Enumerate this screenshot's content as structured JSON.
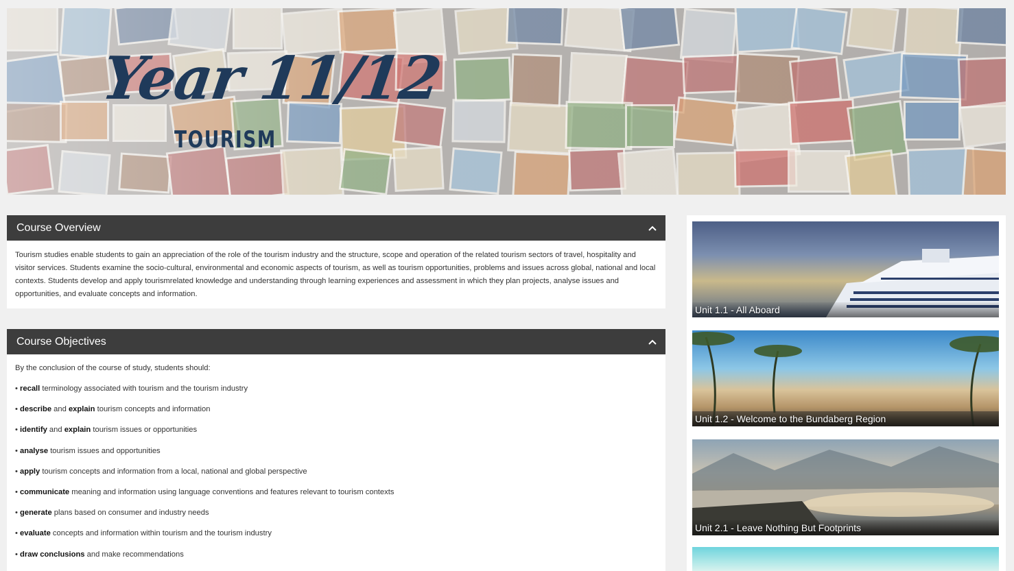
{
  "banner": {
    "title": "Year 11/12",
    "subtitle": "TOURISM"
  },
  "overview": {
    "heading": "Course Overview",
    "text": "Tourism studies enable students to gain an appreciation of the role of the tourism industry and the structure, scope and operation of the related tourism sectors of travel, hospitality and visitor services. Students examine the socio-cultural, environmental and economic aspects of tourism, as well as tourism opportunities, problems and issues across global, national and local contexts. Students develop and apply tourismrelated knowledge and understanding through learning experiences and assessment in which they plan projects, analyse issues and opportunities, and evaluate concepts and information."
  },
  "objectives": {
    "heading": "Course Objectives",
    "intro": "By the conclusion of the course of study, students should:",
    "items": [
      {
        "parts": [
          {
            "b": "recall"
          },
          {
            "t": " terminology associated with tourism and the tourism industry"
          }
        ]
      },
      {
        "parts": [
          {
            "b": "describe"
          },
          {
            "t": " and "
          },
          {
            "b": "explain"
          },
          {
            "t": " tourism concepts and information"
          }
        ]
      },
      {
        "parts": [
          {
            "b": "identify"
          },
          {
            "t": " and "
          },
          {
            "b": "explain"
          },
          {
            "t": " tourism issues or opportunities"
          }
        ]
      },
      {
        "parts": [
          {
            "b": "analyse"
          },
          {
            "t": " tourism issues and opportunities"
          }
        ]
      },
      {
        "parts": [
          {
            "b": "apply"
          },
          {
            "t": " tourism concepts and information from a local, national and global perspective"
          }
        ]
      },
      {
        "parts": [
          {
            "b": "communicate"
          },
          {
            "t": " meaning and information using language conventions and features relevant to tourism contexts"
          }
        ]
      },
      {
        "parts": [
          {
            "b": "generate"
          },
          {
            "t": " plans based on consumer and industry needs"
          }
        ]
      },
      {
        "parts": [
          {
            "b": "evaluate"
          },
          {
            "t": " concepts and information within tourism and the tourism industry"
          }
        ]
      },
      {
        "parts": [
          {
            "b": "draw conclusions"
          },
          {
            "t": " and make recommendations"
          }
        ]
      }
    ]
  },
  "units": [
    {
      "label": "Unit 1.1 - All Aboard"
    },
    {
      "label": "Unit 1.2 - Welcome to the Bundaberg Region"
    },
    {
      "label": "Unit 2.1 - Leave Nothing But Footprints"
    }
  ],
  "icons": {
    "collapse": "chevron-up-icon"
  },
  "colors": {
    "panel_header": "#3d3d3d",
    "banner_title": "#1f3a5a",
    "page_bg": "#f0f0f0"
  }
}
